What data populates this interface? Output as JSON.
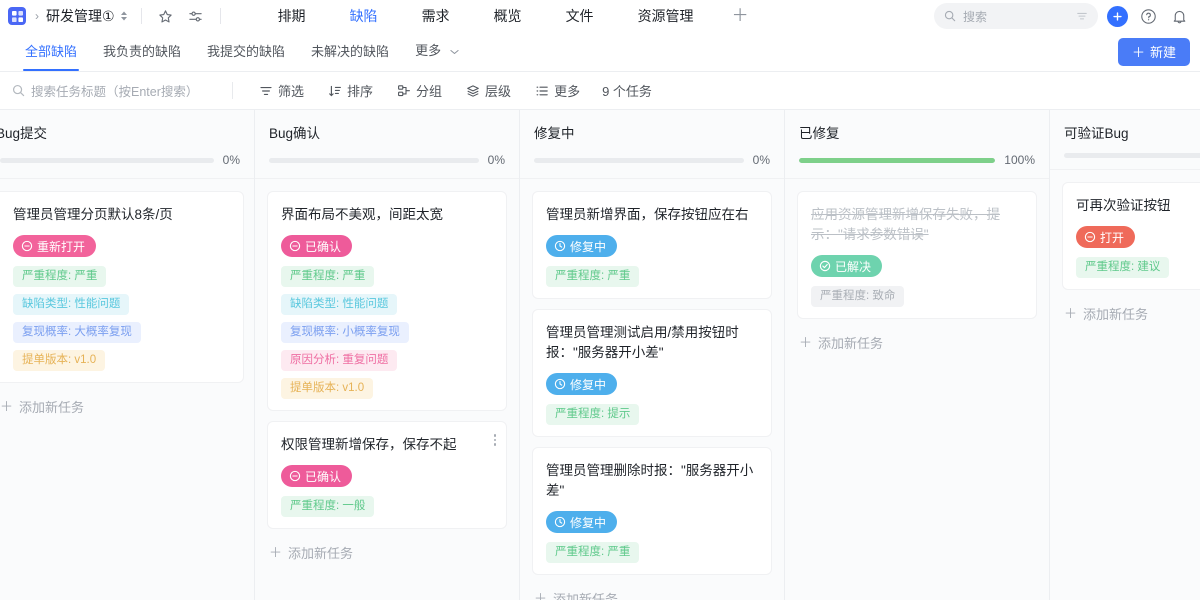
{
  "topbar": {
    "logo_icon": "app-grid-icon",
    "breadcrumb_sep": "›",
    "project_title": "研发管理①",
    "star_icon": "star-icon",
    "settings_icon": "sliders-icon",
    "tabs": [
      {
        "label": "排期",
        "active": false
      },
      {
        "label": "缺陷",
        "active": true
      },
      {
        "label": "需求",
        "active": false
      },
      {
        "label": "概览",
        "active": false
      },
      {
        "label": "文件",
        "active": false
      },
      {
        "label": "资源管理",
        "active": false
      }
    ],
    "add_tab_label": "＋",
    "search_placeholder": "搜索",
    "search_value": "",
    "search_icon": "search-icon",
    "filter_icon": "filter-icon",
    "add_icon": "plus-circle-icon",
    "help_icon": "question-circle-icon",
    "bell_icon": "bell-icon",
    "accent_color": "#3370ff"
  },
  "subtabs": {
    "items": [
      {
        "label": "全部缺陷",
        "active": true
      },
      {
        "label": "我负责的缺陷",
        "active": false
      },
      {
        "label": "我提交的缺陷",
        "active": false
      },
      {
        "label": "未解决的缺陷",
        "active": false
      },
      {
        "label": "更多",
        "active": false,
        "has_chevron": true
      }
    ],
    "new_button": "新建",
    "new_button_plus": "＋"
  },
  "toolbar": {
    "search_placeholder": "搜索任务标题（按Enter搜索）",
    "search_value": "",
    "search_icon": "search-icon",
    "items": [
      {
        "label": "筛选",
        "icon": "filter-icon"
      },
      {
        "label": "排序",
        "icon": "sort-icon"
      },
      {
        "label": "分组",
        "icon": "group-icon"
      },
      {
        "label": "层级",
        "icon": "layers-icon"
      },
      {
        "label": "更多",
        "icon": "list-icon"
      }
    ],
    "task_count": "9 个任务"
  },
  "board": {
    "add_task_label": "添加新任务",
    "add_task_plus": "＋",
    "columns": [
      {
        "title": "Bug提交",
        "progress": 0,
        "progress_label": "0%",
        "cards": [
          {
            "title": "管理员管理分页默认8条/页",
            "status": {
              "label": "重新打开",
              "color": "#f2639b",
              "icon": "minus-circle-icon"
            },
            "done": false,
            "show_more": false,
            "tags": [
              {
                "label": "严重程度: 严重",
                "bg": "#e8f7ee",
                "fg": "#5fc98b"
              },
              {
                "label": "缺陷类型: 性能问题",
                "bg": "#e6f6fa",
                "fg": "#5ac8de"
              },
              {
                "label": "复现概率: 大概率复现",
                "bg": "#eaf0fe",
                "fg": "#7b9ff0"
              },
              {
                "label": "提单版本: v1.0",
                "bg": "#fdf4e2",
                "fg": "#e6b256"
              }
            ]
          }
        ]
      },
      {
        "title": "Bug确认",
        "progress": 0,
        "progress_label": "0%",
        "cards": [
          {
            "title": "界面布局不美观，间距太宽",
            "status": {
              "label": "已确认",
              "color": "#ee5b9a",
              "icon": "minus-circle-icon"
            },
            "done": false,
            "show_more": false,
            "tags": [
              {
                "label": "严重程度: 严重",
                "bg": "#e8f7ee",
                "fg": "#5fc98b"
              },
              {
                "label": "缺陷类型: 性能问题",
                "bg": "#e6f6fa",
                "fg": "#5ac8de"
              },
              {
                "label": "复现概率: 小概率复现",
                "bg": "#eaf0fe",
                "fg": "#7b9ff0"
              },
              {
                "label": "原因分析: 重复问题",
                "bg": "#fdeaf1",
                "fg": "#ef6fa3"
              },
              {
                "label": "提单版本: v1.0",
                "bg": "#fdf4e2",
                "fg": "#e6b256"
              }
            ]
          },
          {
            "title": "权限管理新增保存，保存不起",
            "status": {
              "label": "已确认",
              "color": "#ee5b9a",
              "icon": "minus-circle-icon"
            },
            "done": false,
            "show_more": true,
            "tags": [
              {
                "label": "严重程度: 一般",
                "bg": "#e8f7ee",
                "fg": "#5fc98b"
              }
            ]
          }
        ]
      },
      {
        "title": "修复中",
        "progress": 0,
        "progress_label": "0%",
        "cards": [
          {
            "title": "管理员新增界面，保存按钮应在右",
            "status": {
              "label": "修复中",
              "color": "#4eafec",
              "icon": "clock-icon"
            },
            "done": false,
            "show_more": false,
            "tags": [
              {
                "label": "严重程度: 严重",
                "bg": "#e8f7ee",
                "fg": "#5fc98b"
              }
            ]
          },
          {
            "title": "管理员管理测试启用/禁用按钮时报：\"服务器开小差\"",
            "status": {
              "label": "修复中",
              "color": "#4eafec",
              "icon": "clock-icon"
            },
            "done": false,
            "show_more": false,
            "tags": [
              {
                "label": "严重程度: 提示",
                "bg": "#e8f7ee",
                "fg": "#5fc98b"
              }
            ]
          },
          {
            "title": "管理员管理删除时报：\"服务器开小差\"",
            "status": {
              "label": "修复中",
              "color": "#4eafec",
              "icon": "clock-icon"
            },
            "done": false,
            "show_more": false,
            "tags": [
              {
                "label": "严重程度: 严重",
                "bg": "#e8f7ee",
                "fg": "#5fc98b"
              }
            ]
          }
        ]
      },
      {
        "title": "已修复",
        "progress": 100,
        "progress_label": "100%",
        "cards": [
          {
            "title": "应用资源管理新增保存失败，提示：\"请求参数错误\"",
            "status": {
              "label": "已解决",
              "color": "#6ed3ae",
              "icon": "check-circle-icon"
            },
            "done": true,
            "show_more": false,
            "tags": [
              {
                "label": "严重程度: 致命",
                "bg": "#f1f2f4",
                "fg": "#a9aeb5"
              }
            ]
          }
        ]
      },
      {
        "title": "可验证Bug",
        "progress": 0,
        "progress_label": "",
        "cards": [
          {
            "title": "可再次验证按钮",
            "status": {
              "label": "打开",
              "color": "#ef6a5a",
              "icon": "minus-circle-icon"
            },
            "done": false,
            "show_more": false,
            "tags": [
              {
                "label": "严重程度: 建议",
                "bg": "#e8f7ee",
                "fg": "#5fc98b"
              }
            ]
          }
        ]
      }
    ]
  }
}
